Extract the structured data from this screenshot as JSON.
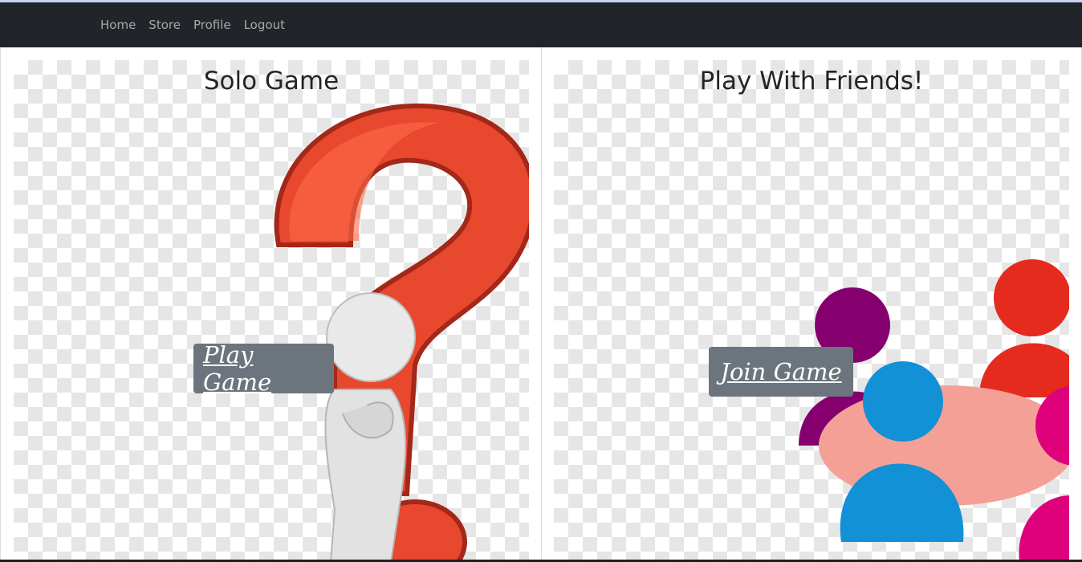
{
  "nav": {
    "items": [
      {
        "label": "Home"
      },
      {
        "label": "Store"
      },
      {
        "label": "Profile"
      },
      {
        "label": "Logout"
      }
    ]
  },
  "solo": {
    "title": "Solo Game",
    "button_label": "Play Game",
    "image_icon": "thinking-figure-question-mark-icon"
  },
  "friends": {
    "title": "Play With Friends!",
    "button_label": "Join Game",
    "image_icon": "group-people-icon"
  },
  "colors": {
    "navbar": "#212529",
    "button": "#6c757d",
    "question_mark": "#e8482d",
    "person_purple": "#85006e",
    "person_red": "#e52a1e",
    "person_blue": "#1291d6",
    "person_pink": "#df007b",
    "table": "#f4a097"
  }
}
